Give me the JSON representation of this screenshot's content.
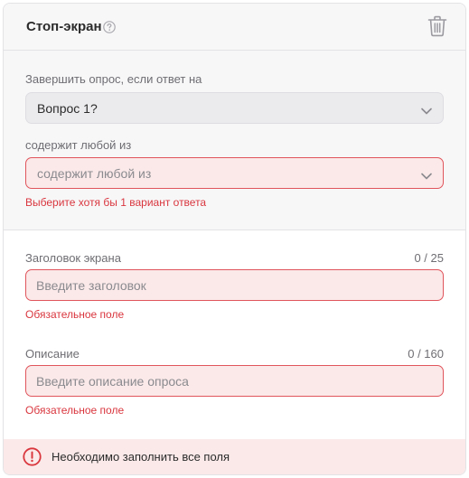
{
  "header": {
    "title": "Стоп-экран",
    "help_icon": "question-circle-icon",
    "delete_icon": "trash-icon"
  },
  "condition": {
    "question_label": "Завершить опрос, если ответ на",
    "question_value": "Вопрос 1?",
    "contains_label": "содержит любой из",
    "contains_placeholder": "содержит любой из",
    "contains_error": "Выберите хотя бы 1 вариант ответа"
  },
  "screen_title": {
    "label": "Заголовок экрана",
    "counter": "0 / 25",
    "placeholder": "Введите заголовок",
    "value": "",
    "error": "Обязательное поле"
  },
  "description": {
    "label": "Описание",
    "counter": "0 / 160",
    "placeholder": "Введите описание опроса",
    "value": "",
    "error": "Обязательное поле"
  },
  "banner": {
    "icon": "error-circle-icon",
    "text": "Необходимо заполнить все поля"
  },
  "colors": {
    "error": "#d9363e",
    "error_background": "#fbe9e9",
    "section_background": "#f7f7f8"
  }
}
